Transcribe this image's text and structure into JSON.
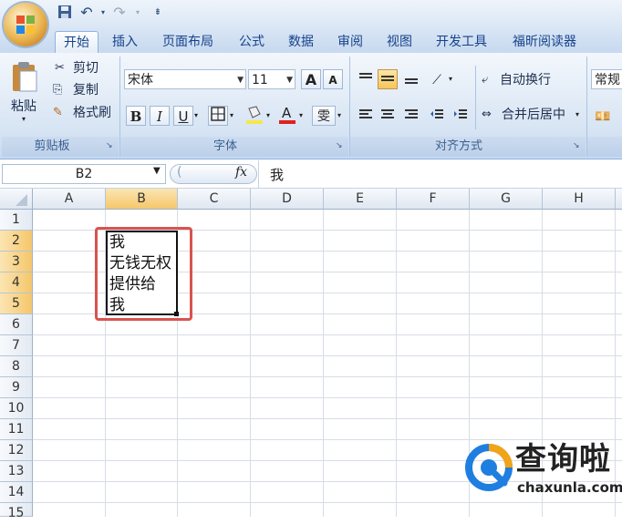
{
  "titlebar": {
    "qat": [
      "save-icon",
      "undo-icon",
      "redo-icon",
      "customize-icon"
    ]
  },
  "tabs": [
    "开始",
    "插入",
    "页面布局",
    "公式",
    "数据",
    "审阅",
    "视图",
    "开发工具",
    "福昕阅读器"
  ],
  "clipboard": {
    "paste": "粘贴",
    "cut": "剪切",
    "copy": "复制",
    "format_painter": "格式刷",
    "group": "剪贴板"
  },
  "font": {
    "name": "宋体",
    "size": "11",
    "bold": "B",
    "italic": "I",
    "underline": "U",
    "grow": "A",
    "shrink": "A",
    "wen": "雯",
    "group": "字体"
  },
  "alignment": {
    "wrap": "自动换行",
    "merge": "合并后居中",
    "group": "对齐方式"
  },
  "number": {
    "format": "常规"
  },
  "formula_bar": {
    "name_box": "B2",
    "fx": "fx",
    "content": "我"
  },
  "columns": [
    "A",
    "B",
    "C",
    "D",
    "E",
    "F",
    "G",
    "H"
  ],
  "rows": [
    "1",
    "2",
    "3",
    "4",
    "5",
    "6",
    "7",
    "8",
    "9",
    "10",
    "11",
    "12",
    "13",
    "14",
    "15"
  ],
  "cell_b2": {
    "lines": [
      "我",
      "无钱无权",
      "提供给",
      "我"
    ]
  },
  "watermark": {
    "brand": "查询啦",
    "url": "chaxunla.com"
  },
  "colors": {
    "accent": "#15428b",
    "selection_header": "#f5c76a",
    "annotation": "#d9534f"
  }
}
